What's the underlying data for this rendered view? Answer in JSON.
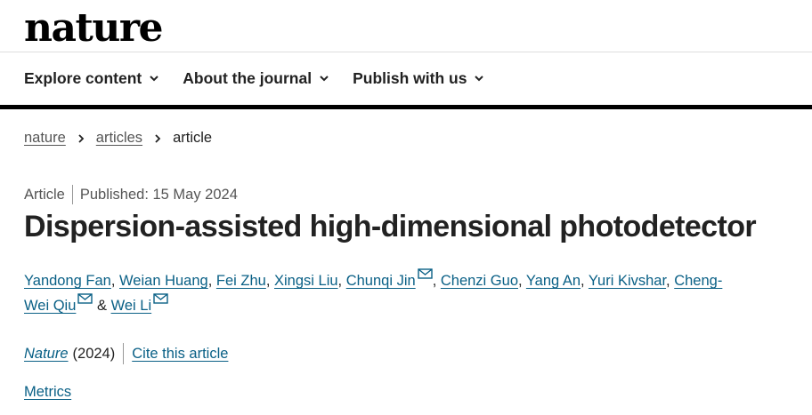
{
  "site": {
    "logo": "nature"
  },
  "nav": {
    "items": [
      {
        "label": "Explore content"
      },
      {
        "label": "About the journal"
      },
      {
        "label": "Publish with us"
      }
    ]
  },
  "breadcrumb": {
    "items": [
      "nature",
      "articles"
    ],
    "current": "article"
  },
  "article": {
    "type": "Article",
    "published": "Published: 15 May 2024",
    "title": "Dispersion-assisted high-dimensional photodetector",
    "authors": [
      "Yandong Fan",
      "Weian Huang",
      "Fei Zhu",
      "Xingsi Liu",
      "Chunqi Jin",
      "Chenzi Guo",
      "Yang An",
      "Yuri Kivshar",
      "Cheng-",
      "Wei Qiu",
      "Wei Li"
    ],
    "and_text": "&",
    "journal": "Nature",
    "year": "(2024)",
    "cite_label": "Cite this article",
    "metrics_label": "Metrics"
  },
  "colors": {
    "link": "#0a6086",
    "text": "#222222",
    "muted": "#555555"
  },
  "icons": {
    "nav_chevron": "chevron-down-icon",
    "breadcrumb_separator": "chevron-right-icon",
    "author_contact": "mail-icon"
  }
}
